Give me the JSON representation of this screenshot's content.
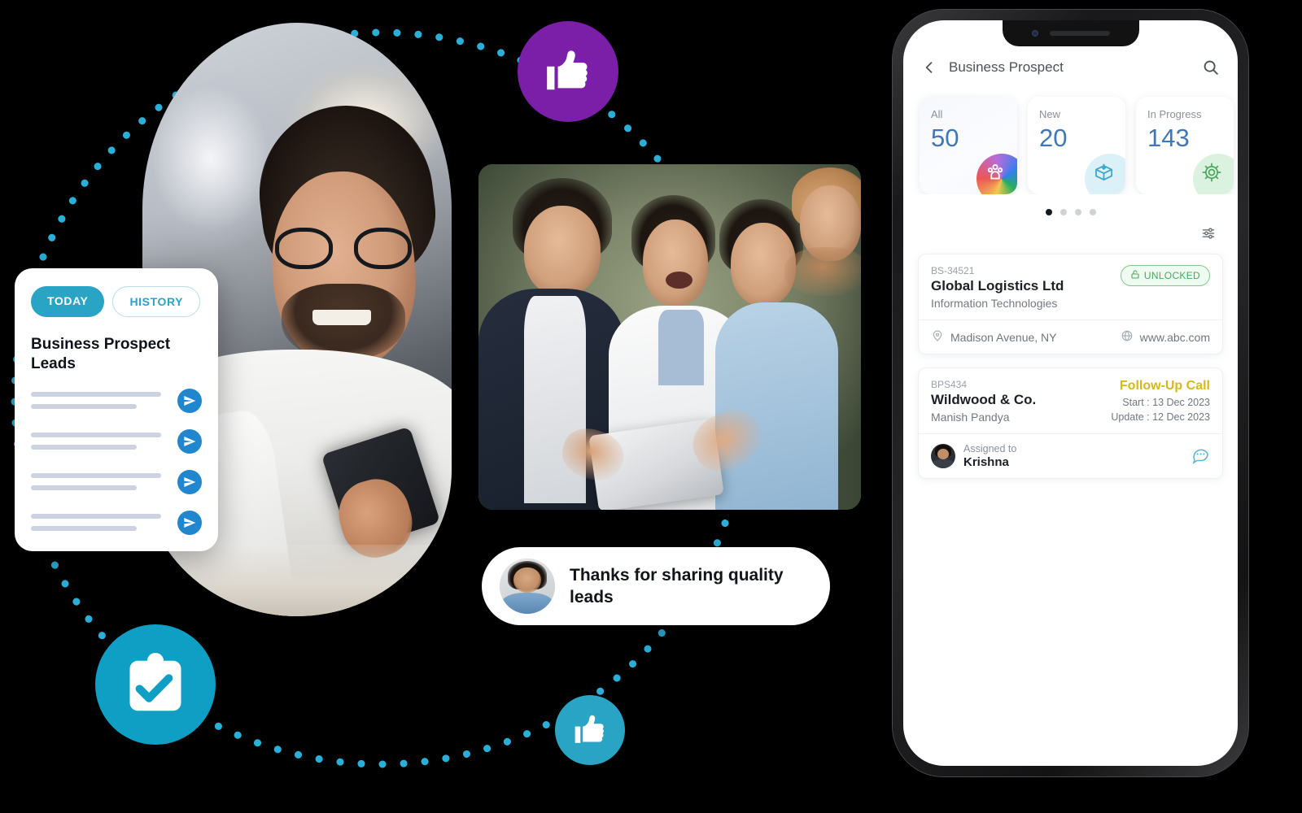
{
  "theme": {
    "background": "#000000",
    "accent_teal": "#2aa4c4",
    "accent_purple": "#7b1fa9",
    "accent_blue": "#2086ce",
    "stat_value_blue": "#4177b4",
    "unlocked_green": "#4aa85c",
    "followup_yellow": "#d4b81e",
    "dot_color": "#2ab0d8"
  },
  "leads_card": {
    "tabs": [
      {
        "label": "TODAY",
        "active": true
      },
      {
        "label": "HISTORY",
        "active": false
      }
    ],
    "title": "Business Prospect Leads",
    "rows": [
      {
        "icon": "send-icon"
      },
      {
        "icon": "send-icon"
      },
      {
        "icon": "send-icon"
      },
      {
        "icon": "send-icon"
      }
    ]
  },
  "badges": [
    {
      "name": "thumbs-up-purple",
      "icon": "thumbs-up-icon",
      "color": "#7b1fa9"
    },
    {
      "name": "clipboard-check",
      "icon": "clipboard-check-icon",
      "color": "#0f9fc4"
    },
    {
      "name": "thumbs-up-teal",
      "icon": "thumbs-up-icon",
      "color": "#2aa4c4"
    }
  ],
  "testimonial": {
    "message": "Thanks for sharing quality leads",
    "avatar": "user-avatar"
  },
  "phone": {
    "header": {
      "back_icon": "chevron-left-icon",
      "title": "Business Prospect",
      "search_icon": "search-icon"
    },
    "stats": [
      {
        "label": "All",
        "value": "50",
        "icon": "group-people-icon",
        "badge_style": "rainbow"
      },
      {
        "label": "New",
        "value": "20",
        "icon": "box-download-icon",
        "badge_style": "blue"
      },
      {
        "label": "In Progress",
        "value": "143",
        "icon": "gear-progress-icon",
        "badge_style": "green"
      }
    ],
    "pager": {
      "count": 4,
      "active_index": 0
    },
    "filter_icon": "filter-sliders-icon",
    "leads": [
      {
        "code": "BS-34521",
        "name": "Global Logistics Ltd",
        "subtitle": "Information Technologies",
        "status": {
          "label": "UNLOCKED",
          "icon": "unlock-icon",
          "type": "unlocked"
        },
        "location": {
          "icon": "location-pin-icon",
          "text": "Madison Avenue, NY"
        },
        "website": {
          "icon": "globe-icon",
          "text": "www.abc.com"
        }
      },
      {
        "code": "BPS434",
        "name": "Wildwood & Co.",
        "subtitle": "Manish Pandya",
        "status": {
          "label": "Follow-Up Call",
          "type": "followup"
        },
        "start_date": "Start : 13 Dec 2023",
        "update_date": "Update : 12 Dec 2023",
        "assigned": {
          "label": "Assigned to",
          "name": "Krishna",
          "avatar": "assignee-avatar"
        },
        "chat_icon": "chat-bubble-icon"
      }
    ]
  }
}
